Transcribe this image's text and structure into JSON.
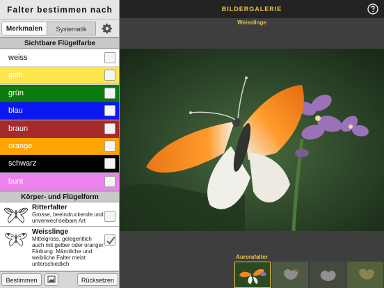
{
  "left_panel": {
    "title": "Falter bestimmen nach",
    "tabs": [
      {
        "label": "Merkmalen",
        "selected": true
      },
      {
        "label": "Systematik",
        "selected": false
      }
    ],
    "settings_icon": "gear-icon",
    "section_wing_color": "Sichtbare Flügelfarbe",
    "colors": [
      {
        "label": "weiss",
        "bg": "#ffffff",
        "fg": "#111111",
        "checked": false
      },
      {
        "label": "gelb",
        "bg": "#fde64b",
        "fg": "#ffffff",
        "checked": false
      },
      {
        "label": "grün",
        "bg": "#0c7b0d",
        "fg": "#ffffff",
        "checked": false
      },
      {
        "label": "blau",
        "bg": "#0c18f2",
        "fg": "#ffffff",
        "checked": false
      },
      {
        "label": "braun",
        "bg": "#a52a2a",
        "fg": "#ffffff",
        "checked": false
      },
      {
        "label": "orange",
        "bg": "#fea400",
        "fg": "#ffffff",
        "checked": false
      },
      {
        "label": "schwarz",
        "bg": "#000000",
        "fg": "#ffffff",
        "checked": false
      },
      {
        "label": "bunt",
        "bg": "#ed82ee",
        "fg": "#ffffff",
        "checked": false
      }
    ],
    "section_body_shape": "Körper- und Flügelform",
    "species": [
      {
        "name": "Ritterfalter",
        "description": "Grosse, beeindruckende und unverwechselbare Art",
        "checked": false
      },
      {
        "name": "Weisslinge",
        "description": "Mittelgross, gelegentlich auch mit gelber oder oranger Färbung. Männliche und weibliche Falter meist unterschiedlich",
        "checked": true
      }
    ],
    "buttons": {
      "determine": "Bestimmen",
      "reset": "Rücksetzen",
      "image_icon": "image-icon"
    }
  },
  "gallery": {
    "title": "BILDERGALERIE",
    "help_icon": "help-icon",
    "species_title": "Weisslinge",
    "thumb_label": "Aurorafalter",
    "accent": "#e6c34a"
  }
}
